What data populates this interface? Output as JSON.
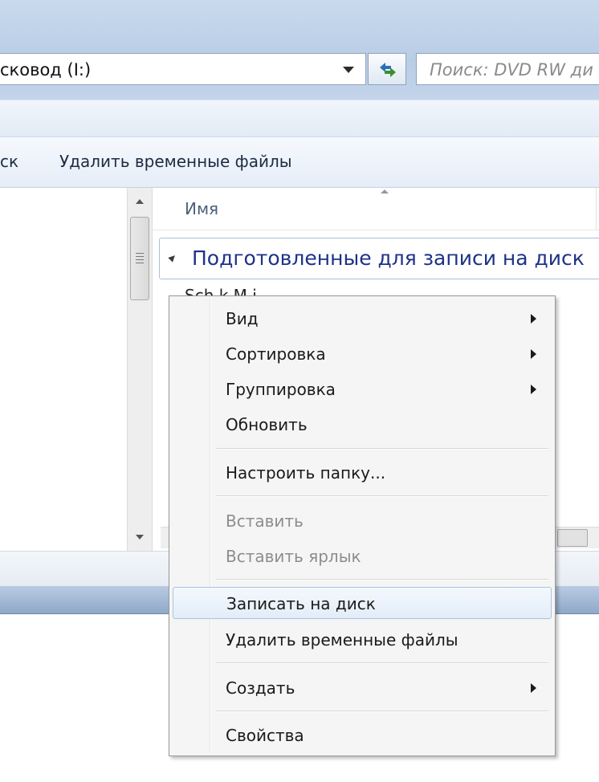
{
  "address_bar": {
    "path": "сковод (I:)"
  },
  "search": {
    "placeholder": "Поиск: DVD RW ди"
  },
  "toolbar": {
    "partial_item": "ск",
    "delete_temp": "Удалить временные файлы"
  },
  "file_list": {
    "column_name": "Имя",
    "group_header": "Подготовленные для записи на диск",
    "partial_row": "Sch k M i"
  },
  "context_menu": {
    "items": [
      {
        "label": "Вид",
        "submenu": true,
        "disabled": false
      },
      {
        "label": "Сортировка",
        "submenu": true,
        "disabled": false
      },
      {
        "label": "Группировка",
        "submenu": true,
        "disabled": false
      },
      {
        "label": "Обновить",
        "submenu": false,
        "disabled": false
      },
      {
        "label": "Настроить папку...",
        "submenu": false,
        "disabled": false
      },
      {
        "label": "Вставить",
        "submenu": false,
        "disabled": true
      },
      {
        "label": "Вставить ярлык",
        "submenu": false,
        "disabled": true
      },
      {
        "label": "Записать на диск",
        "submenu": false,
        "disabled": false,
        "highlighted": true
      },
      {
        "label": "Удалить временные файлы",
        "submenu": false,
        "disabled": false
      },
      {
        "label": "Создать",
        "submenu": true,
        "disabled": false
      },
      {
        "label": "Свойства",
        "submenu": false,
        "disabled": false
      }
    ]
  },
  "colors": {
    "frame": "#b9cde6",
    "group_text": "#1e3287",
    "menu_bg": "#f5f5f5",
    "highlight_border": "#a8c3e2",
    "disabled_text": "#8d8d8d"
  }
}
